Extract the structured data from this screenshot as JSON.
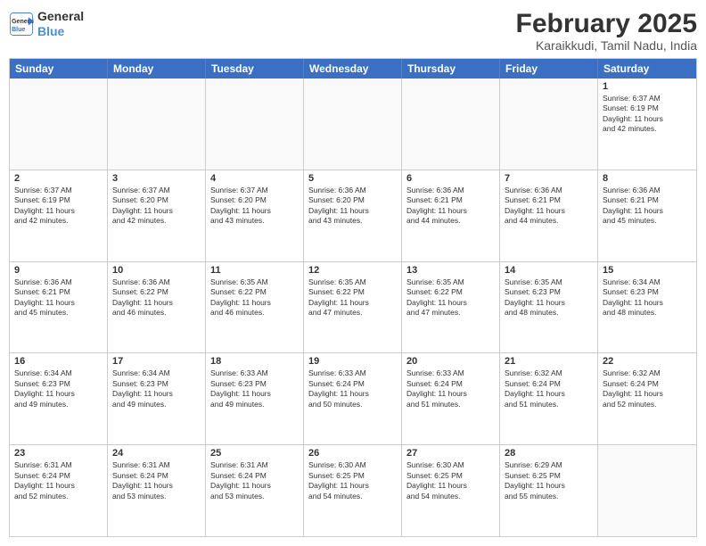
{
  "header": {
    "logo_line1": "General",
    "logo_line2": "Blue",
    "title": "February 2025",
    "subtitle": "Karaikkudi, Tamil Nadu, India"
  },
  "days": [
    "Sunday",
    "Monday",
    "Tuesday",
    "Wednesday",
    "Thursday",
    "Friday",
    "Saturday"
  ],
  "rows": [
    [
      {
        "day": "",
        "info": ""
      },
      {
        "day": "",
        "info": ""
      },
      {
        "day": "",
        "info": ""
      },
      {
        "day": "",
        "info": ""
      },
      {
        "day": "",
        "info": ""
      },
      {
        "day": "",
        "info": ""
      },
      {
        "day": "1",
        "info": "Sunrise: 6:37 AM\nSunset: 6:19 PM\nDaylight: 11 hours\nand 42 minutes."
      }
    ],
    [
      {
        "day": "2",
        "info": "Sunrise: 6:37 AM\nSunset: 6:19 PM\nDaylight: 11 hours\nand 42 minutes."
      },
      {
        "day": "3",
        "info": "Sunrise: 6:37 AM\nSunset: 6:20 PM\nDaylight: 11 hours\nand 42 minutes."
      },
      {
        "day": "4",
        "info": "Sunrise: 6:37 AM\nSunset: 6:20 PM\nDaylight: 11 hours\nand 43 minutes."
      },
      {
        "day": "5",
        "info": "Sunrise: 6:36 AM\nSunset: 6:20 PM\nDaylight: 11 hours\nand 43 minutes."
      },
      {
        "day": "6",
        "info": "Sunrise: 6:36 AM\nSunset: 6:21 PM\nDaylight: 11 hours\nand 44 minutes."
      },
      {
        "day": "7",
        "info": "Sunrise: 6:36 AM\nSunset: 6:21 PM\nDaylight: 11 hours\nand 44 minutes."
      },
      {
        "day": "8",
        "info": "Sunrise: 6:36 AM\nSunset: 6:21 PM\nDaylight: 11 hours\nand 45 minutes."
      }
    ],
    [
      {
        "day": "9",
        "info": "Sunrise: 6:36 AM\nSunset: 6:21 PM\nDaylight: 11 hours\nand 45 minutes."
      },
      {
        "day": "10",
        "info": "Sunrise: 6:36 AM\nSunset: 6:22 PM\nDaylight: 11 hours\nand 46 minutes."
      },
      {
        "day": "11",
        "info": "Sunrise: 6:35 AM\nSunset: 6:22 PM\nDaylight: 11 hours\nand 46 minutes."
      },
      {
        "day": "12",
        "info": "Sunrise: 6:35 AM\nSunset: 6:22 PM\nDaylight: 11 hours\nand 47 minutes."
      },
      {
        "day": "13",
        "info": "Sunrise: 6:35 AM\nSunset: 6:22 PM\nDaylight: 11 hours\nand 47 minutes."
      },
      {
        "day": "14",
        "info": "Sunrise: 6:35 AM\nSunset: 6:23 PM\nDaylight: 11 hours\nand 48 minutes."
      },
      {
        "day": "15",
        "info": "Sunrise: 6:34 AM\nSunset: 6:23 PM\nDaylight: 11 hours\nand 48 minutes."
      }
    ],
    [
      {
        "day": "16",
        "info": "Sunrise: 6:34 AM\nSunset: 6:23 PM\nDaylight: 11 hours\nand 49 minutes."
      },
      {
        "day": "17",
        "info": "Sunrise: 6:34 AM\nSunset: 6:23 PM\nDaylight: 11 hours\nand 49 minutes."
      },
      {
        "day": "18",
        "info": "Sunrise: 6:33 AM\nSunset: 6:23 PM\nDaylight: 11 hours\nand 49 minutes."
      },
      {
        "day": "19",
        "info": "Sunrise: 6:33 AM\nSunset: 6:24 PM\nDaylight: 11 hours\nand 50 minutes."
      },
      {
        "day": "20",
        "info": "Sunrise: 6:33 AM\nSunset: 6:24 PM\nDaylight: 11 hours\nand 51 minutes."
      },
      {
        "day": "21",
        "info": "Sunrise: 6:32 AM\nSunset: 6:24 PM\nDaylight: 11 hours\nand 51 minutes."
      },
      {
        "day": "22",
        "info": "Sunrise: 6:32 AM\nSunset: 6:24 PM\nDaylight: 11 hours\nand 52 minutes."
      }
    ],
    [
      {
        "day": "23",
        "info": "Sunrise: 6:31 AM\nSunset: 6:24 PM\nDaylight: 11 hours\nand 52 minutes."
      },
      {
        "day": "24",
        "info": "Sunrise: 6:31 AM\nSunset: 6:24 PM\nDaylight: 11 hours\nand 53 minutes."
      },
      {
        "day": "25",
        "info": "Sunrise: 6:31 AM\nSunset: 6:24 PM\nDaylight: 11 hours\nand 53 minutes."
      },
      {
        "day": "26",
        "info": "Sunrise: 6:30 AM\nSunset: 6:25 PM\nDaylight: 11 hours\nand 54 minutes."
      },
      {
        "day": "27",
        "info": "Sunrise: 6:30 AM\nSunset: 6:25 PM\nDaylight: 11 hours\nand 54 minutes."
      },
      {
        "day": "28",
        "info": "Sunrise: 6:29 AM\nSunset: 6:25 PM\nDaylight: 11 hours\nand 55 minutes."
      },
      {
        "day": "",
        "info": ""
      }
    ]
  ]
}
